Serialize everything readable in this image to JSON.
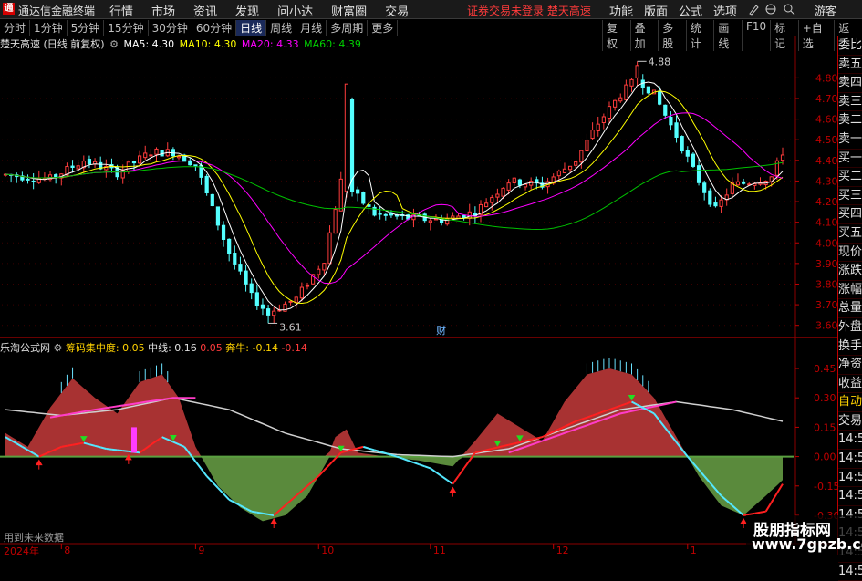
{
  "titlebar": {
    "logo_char": "通",
    "app_name": "通达信金融终端",
    "menu": [
      "行情",
      "市场",
      "资讯",
      "发现",
      "问小达",
      "财富圈",
      "交易"
    ],
    "alert": "证券交易未登录  楚天高速",
    "right_menu": [
      "功能",
      "版面",
      "公式",
      "选项"
    ],
    "right_icons": [
      "pen-icon",
      "globe-icon",
      "search-icon"
    ],
    "guest": "游客"
  },
  "periodbar": {
    "periods": [
      "分时",
      "1分钟",
      "5分钟",
      "15分钟",
      "30分钟",
      "60分钟",
      "日线",
      "周线",
      "月线",
      "多周期",
      "更多"
    ],
    "active": "日线",
    "tools": [
      "复权",
      "叠加",
      "多股",
      "统计",
      "画线",
      "F10",
      "标记",
      "+自选",
      "返回"
    ]
  },
  "main_header": {
    "stock": "楚天高速 (日线 前复权)",
    "ma5": "MA5: 4.30",
    "ma10": "MA10: 4.30",
    "ma20": "MA20: 4.33",
    "ma60": "MA60: 4.39"
  },
  "indicator_header": {
    "name": "乐淘公式网",
    "label1": "筹码集中度: 0.05",
    "label2": "中线: 0.16",
    "label3": "0.05",
    "label4": "奔牛: -0.14",
    "label5": "-0.14"
  },
  "main_axis": {
    "labels": [
      "4.80",
      "4.70",
      "4.60",
      "4.50",
      "4.40",
      "4.30",
      "4.20",
      "4.10",
      "4.00",
      "3.90",
      "3.80",
      "3.70",
      "3.60"
    ]
  },
  "indicator_axis": {
    "labels": [
      "0.45",
      "0.30",
      "0.15",
      "0.00",
      "-0.15",
      "-0.30"
    ]
  },
  "annotations": {
    "high": "4.88",
    "low": "3.61",
    "cai": "财"
  },
  "right_panel": [
    "委比",
    "卖五",
    "卖四",
    "卖三",
    "卖二",
    "卖一",
    "买一",
    "买二",
    "买三",
    "买四",
    "买五",
    "现价",
    "涨跌",
    "涨幅",
    "总量",
    "外盘",
    "换手",
    "净资",
    "收益",
    "自动",
    "交易",
    "14:56",
    "14:56",
    "14:56",
    "14:56",
    "14:56",
    "14:56",
    "14:56",
    "14:56"
  ],
  "bottom": {
    "text": "用到未来数据",
    "year": "2024年"
  },
  "xaxis": {
    "months": [
      "8",
      "9",
      "10",
      "11",
      "12",
      "1"
    ]
  },
  "watermark": {
    "line1": "股朋指标网",
    "line2": "www.7gpzb.com"
  },
  "colors": {
    "up": "#ff3c3c",
    "down": "#54ffff",
    "ma5": "#ffffff",
    "ma10": "#ffff00",
    "ma20": "#ff00ff",
    "ma60": "#00c000",
    "grid_red": "#8b0000"
  }
}
